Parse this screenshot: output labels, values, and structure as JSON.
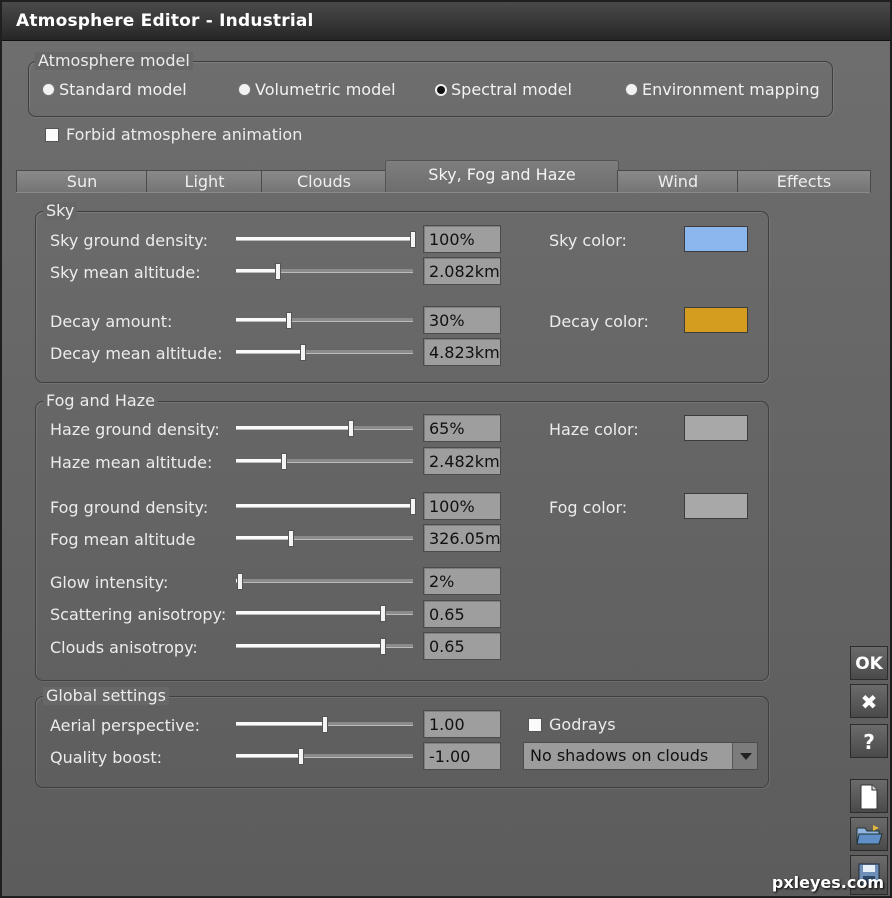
{
  "window": {
    "title": "Atmosphere Editor - Industrial"
  },
  "model": {
    "group_title": "Atmosphere model",
    "options": [
      {
        "label": "Standard model",
        "selected": false
      },
      {
        "label": "Volumetric model",
        "selected": false
      },
      {
        "label": "Spectral model",
        "selected": true
      },
      {
        "label": "Environment mapping",
        "selected": false
      }
    ],
    "forbid_animation": {
      "label": "Forbid atmosphere animation",
      "checked": false
    }
  },
  "tabs": [
    {
      "label": "Sun",
      "active": false
    },
    {
      "label": "Light",
      "active": false
    },
    {
      "label": "Clouds",
      "active": false
    },
    {
      "label": "Sky, Fog and Haze",
      "active": true
    },
    {
      "label": "Wind",
      "active": false
    },
    {
      "label": "Effects",
      "active": false
    }
  ],
  "sky": {
    "title": "Sky",
    "rows": [
      {
        "label": "Sky ground density:",
        "value": "100%",
        "level": 1.0
      },
      {
        "label": "Sky mean altitude:",
        "value": "2.082km",
        "level": 0.24
      },
      {
        "label": "Decay amount:",
        "value": "30%",
        "level": 0.3
      },
      {
        "label": "Decay mean altitude:",
        "value": "4.823km",
        "level": 0.38
      }
    ],
    "sky_color": {
      "label": "Sky color:",
      "color": "#8cb6ee"
    },
    "decay_color": {
      "label": "Decay color:",
      "color": "#d49d20"
    }
  },
  "fog": {
    "title": "Fog and Haze",
    "rows": [
      {
        "label": "Haze ground density:",
        "value": "65%",
        "level": 0.65
      },
      {
        "label": "Haze mean altitude:",
        "value": "2.482km",
        "level": 0.27
      },
      {
        "label": "Fog ground density:",
        "value": "100%",
        "level": 1.0
      },
      {
        "label": "Fog mean altitude",
        "value": "326.05m",
        "level": 0.31
      },
      {
        "label": "Glow intensity:",
        "value": "2%",
        "level": 0.02
      },
      {
        "label": "Scattering anisotropy:",
        "value": "0.65",
        "level": 0.83
      },
      {
        "label": "Clouds anisotropy:",
        "value": "0.65",
        "level": 0.83
      }
    ],
    "haze_color": {
      "label": "Haze color:",
      "color": "#a8a8a8"
    },
    "fog_color": {
      "label": "Fog color:",
      "color": "#a8a8a8"
    }
  },
  "global": {
    "title": "Global settings",
    "rows": [
      {
        "label": "Aerial perspective:",
        "value": "1.00",
        "level": 0.5
      },
      {
        "label": "Quality boost:",
        "value": "-1.00",
        "level": 0.37
      }
    ],
    "godrays": {
      "label": "Godrays",
      "checked": false
    },
    "shadows_select": {
      "value": "No shadows on clouds"
    }
  },
  "side_buttons": {
    "ok": "OK",
    "cancel": "✖",
    "help": "?"
  },
  "watermark": "pxleyes.com"
}
